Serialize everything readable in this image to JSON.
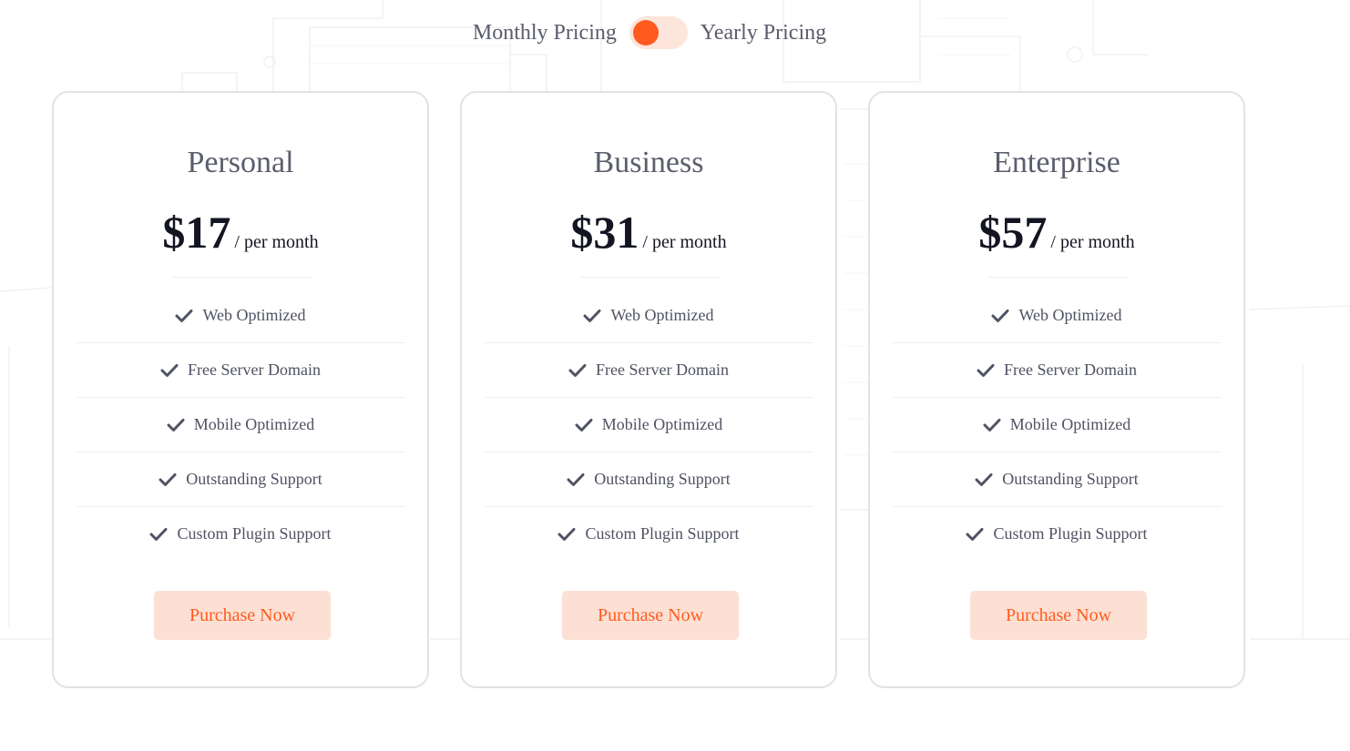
{
  "toggle": {
    "monthly_label": "Monthly Pricing",
    "yearly_label": "Yearly Pricing",
    "selected": "monthly"
  },
  "colors": {
    "accent": "#ff5b1f",
    "accent_soft": "#fde0d4",
    "text_dark": "#141522",
    "text_muted": "#5b5e6c"
  },
  "plans": [
    {
      "name": "Personal",
      "price": "$17",
      "period": "/ per month",
      "features": [
        "Web Optimized",
        "Free Server Domain",
        "Mobile Optimized",
        "Outstanding Support",
        "Custom Plugin Support"
      ],
      "button_label": "Purchase Now"
    },
    {
      "name": "Business",
      "price": "$31",
      "period": "/ per month",
      "features": [
        "Web Optimized",
        "Free Server Domain",
        "Mobile Optimized",
        "Outstanding Support",
        "Custom Plugin Support"
      ],
      "button_label": "Purchase Now"
    },
    {
      "name": "Enterprise",
      "price": "$57",
      "period": "/ per month",
      "features": [
        "Web Optimized",
        "Free Server Domain",
        "Mobile Optimized",
        "Outstanding Support",
        "Custom Plugin Support"
      ],
      "button_label": "Purchase Now"
    }
  ],
  "icons": {
    "feature": "check-icon"
  }
}
